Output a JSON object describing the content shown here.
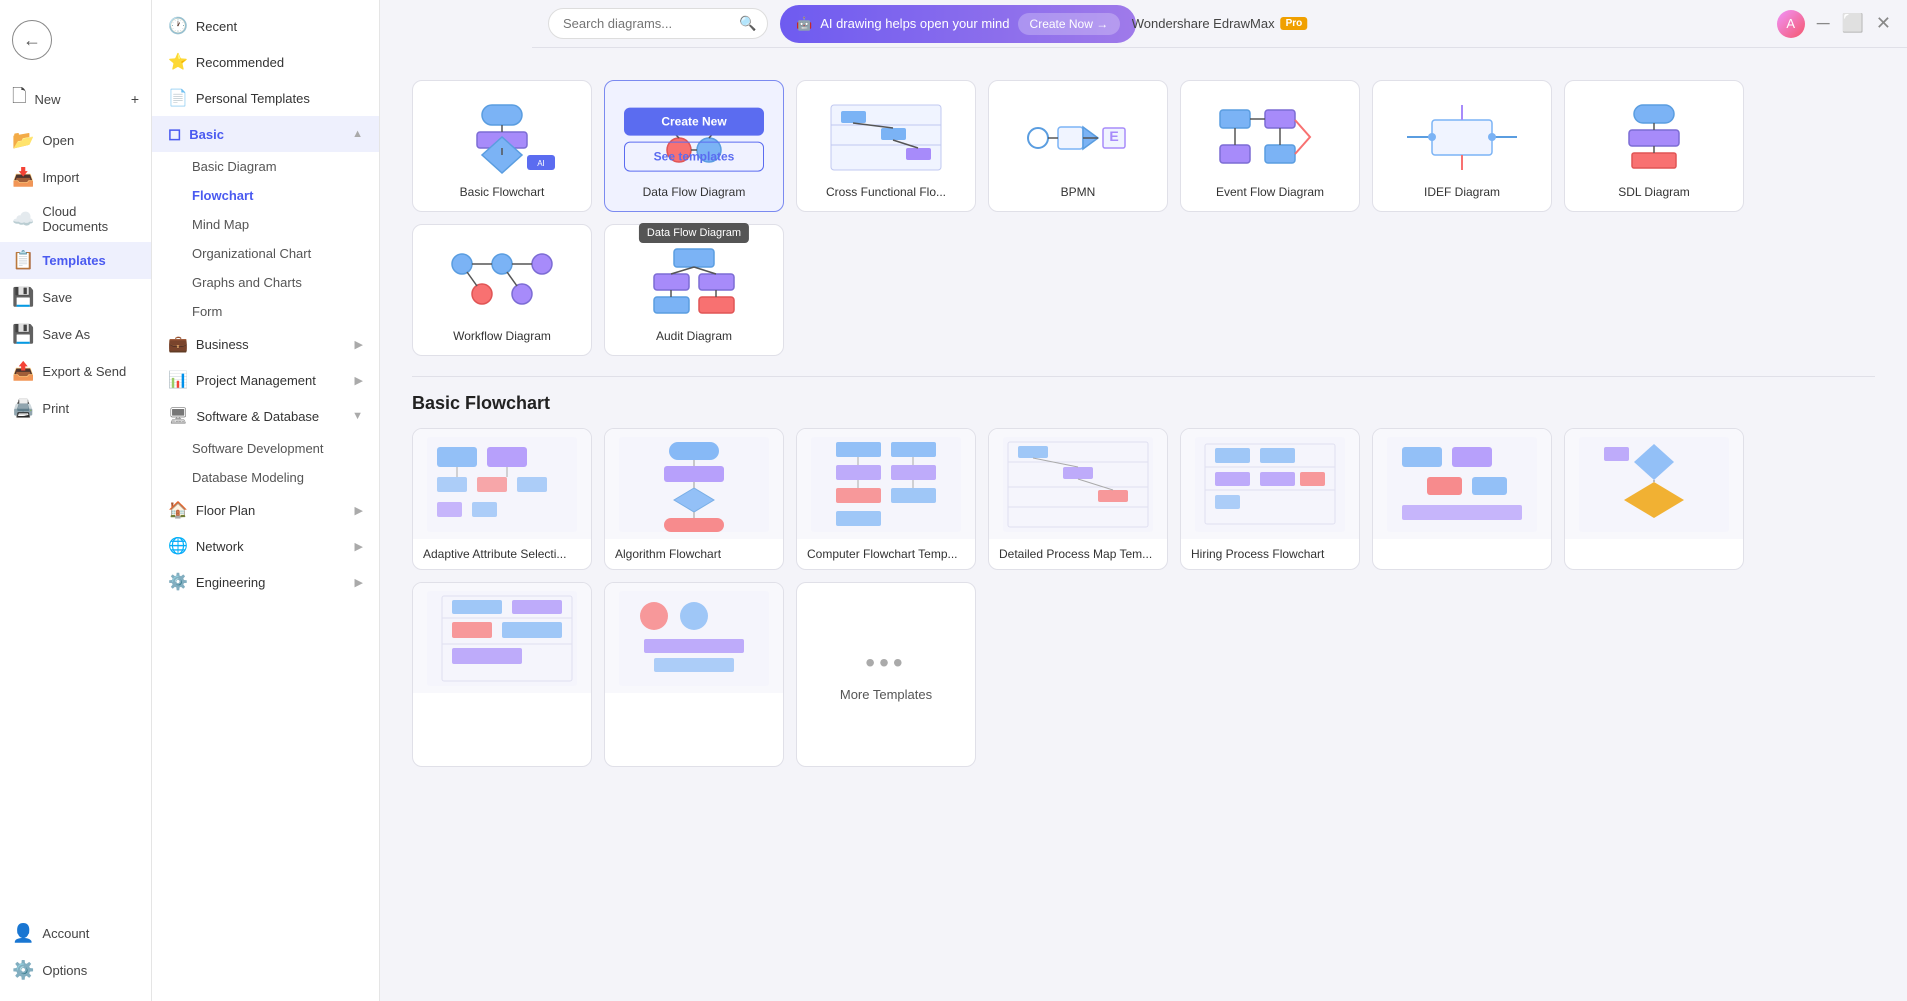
{
  "app": {
    "title": "Wondershare EdrawMax",
    "pro_badge": "Pro",
    "window_controls": [
      "minimize",
      "maximize",
      "close"
    ]
  },
  "sidebar_narrow": {
    "items": [
      {
        "id": "new",
        "label": "New",
        "icon": "🗋",
        "has_plus": true
      },
      {
        "id": "open",
        "label": "Open",
        "icon": "📂"
      },
      {
        "id": "import",
        "label": "Import",
        "icon": "📥"
      },
      {
        "id": "cloud",
        "label": "Cloud Documents",
        "icon": "☁️"
      },
      {
        "id": "templates",
        "label": "Templates",
        "icon": "📋",
        "active": true
      },
      {
        "id": "save",
        "label": "Save",
        "icon": "💾"
      },
      {
        "id": "save_as",
        "label": "Save As",
        "icon": "💾"
      },
      {
        "id": "export",
        "label": "Export & Send",
        "icon": "📤"
      },
      {
        "id": "print",
        "label": "Print",
        "icon": "🖨️"
      }
    ],
    "bottom_items": [
      {
        "id": "account",
        "label": "Account",
        "icon": "👤"
      },
      {
        "id": "options",
        "label": "Options",
        "icon": "⚙️"
      }
    ]
  },
  "sidebar_wide": {
    "categories": [
      {
        "id": "recent",
        "label": "Recent",
        "icon": "🕐"
      },
      {
        "id": "recommended",
        "label": "Recommended",
        "icon": "⭐"
      },
      {
        "id": "personal_templates",
        "label": "Personal Templates",
        "icon": "📄"
      },
      {
        "id": "basic",
        "label": "Basic",
        "icon": "◻",
        "expanded": true,
        "active": true,
        "children": [
          {
            "id": "basic_diagram",
            "label": "Basic Diagram"
          },
          {
            "id": "flowchart",
            "label": "Flowchart",
            "active": true
          },
          {
            "id": "mind_map",
            "label": "Mind Map"
          },
          {
            "id": "org_chart",
            "label": "Organizational Chart"
          },
          {
            "id": "graphs_charts",
            "label": "Graphs and Charts"
          },
          {
            "id": "form",
            "label": "Form"
          }
        ]
      },
      {
        "id": "business",
        "label": "Business",
        "icon": "💼",
        "has_arrow": true
      },
      {
        "id": "project_mgmt",
        "label": "Project Management",
        "icon": "📊",
        "has_arrow": true
      },
      {
        "id": "software_db",
        "label": "Software & Database",
        "icon": "🖥",
        "expanded": true,
        "children": [
          {
            "id": "software_dev",
            "label": "Software Development"
          },
          {
            "id": "db_modeling",
            "label": "Database Modeling"
          }
        ]
      },
      {
        "id": "floor_plan",
        "label": "Floor Plan",
        "icon": "🏠",
        "has_arrow": true
      },
      {
        "id": "network",
        "label": "Network",
        "icon": "🌐",
        "has_arrow": true
      },
      {
        "id": "engineering",
        "label": "Engineering",
        "icon": "⚙️",
        "has_arrow": true
      }
    ]
  },
  "search": {
    "placeholder": "Search diagrams..."
  },
  "ai_banner": {
    "text": "AI drawing helps open your mind",
    "button_label": "Create Now →"
  },
  "diagram_types": [
    {
      "id": "basic_flowchart",
      "label": "Basic Flowchart",
      "selected": false
    },
    {
      "id": "data_flow",
      "label": "Data Flow Diagram",
      "selected": true,
      "tooltip": "Data Flow Diagram"
    },
    {
      "id": "cross_functional",
      "label": "Cross Functional Flo...",
      "selected": false
    },
    {
      "id": "bpmn",
      "label": "BPMN",
      "selected": false
    },
    {
      "id": "event_flow",
      "label": "Event Flow Diagram",
      "selected": false
    },
    {
      "id": "idef",
      "label": "IDEF Diagram",
      "selected": false
    },
    {
      "id": "sdl",
      "label": "SDL Diagram",
      "selected": false
    },
    {
      "id": "workflow",
      "label": "Workflow Diagram",
      "selected": false
    },
    {
      "id": "audit",
      "label": "Audit Diagram",
      "selected": false
    }
  ],
  "section_title": "Basic Flowchart",
  "templates": [
    {
      "id": "t1",
      "label": "Adaptive Attribute Selecti..."
    },
    {
      "id": "t2",
      "label": "Algorithm Flowchart"
    },
    {
      "id": "t3",
      "label": "Computer Flowchart Temp..."
    },
    {
      "id": "t4",
      "label": "Detailed Process Map Tem..."
    },
    {
      "id": "t5",
      "label": "Hiring Process Flowchart"
    },
    {
      "id": "t6",
      "label": ""
    },
    {
      "id": "t7",
      "label": ""
    },
    {
      "id": "t8",
      "label": ""
    },
    {
      "id": "t9",
      "label": ""
    }
  ],
  "more_templates": {
    "label": "More Templates",
    "dots": "•••"
  },
  "card_overlay": {
    "create_new": "Create New",
    "see_templates": "See templates"
  }
}
